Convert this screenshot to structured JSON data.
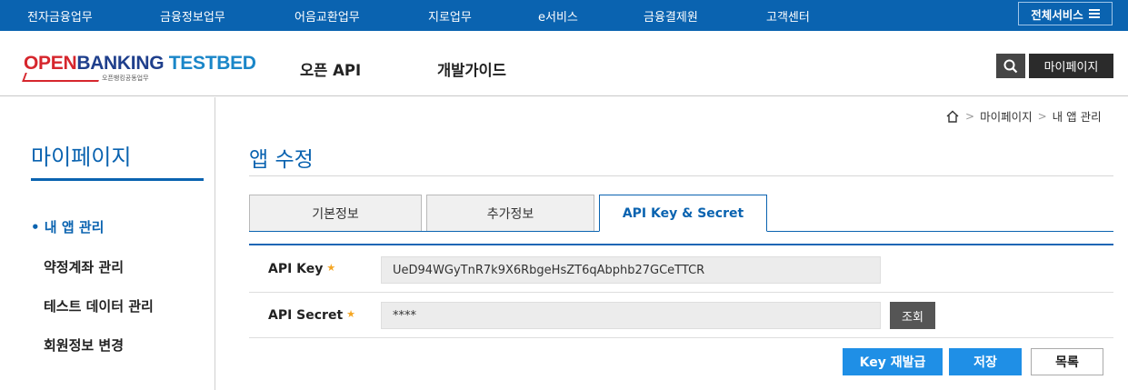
{
  "top_menu": [
    "전자금융업무",
    "금융정보업무",
    "어음교환업무",
    "지로업무",
    "e서비스",
    "금융결제원",
    "고객센터"
  ],
  "all_services_label": "전체서비스",
  "logo": {
    "open": "OPEN",
    "banking": "BANKING",
    "testbed": " TESTBED",
    "subtitle": "오픈뱅킹공동업무"
  },
  "gnb": [
    "오픈 API",
    "개발가이드"
  ],
  "header_buttons": {
    "search_icon": "search-icon",
    "mypage": "마이페이지"
  },
  "sidebar": {
    "title": "마이페이지",
    "items": [
      {
        "label": "• 내 앱 관리",
        "active": true
      },
      {
        "label": "약정계좌 관리",
        "active": false
      },
      {
        "label": "테스트 데이터 관리",
        "active": false
      },
      {
        "label": "회원정보 변경",
        "active": false
      }
    ]
  },
  "breadcrumb": {
    "home_icon": "home-icon",
    "items": [
      "마이페이지",
      "내 앱 관리"
    ]
  },
  "page_title": "앱 수정",
  "tabs": [
    {
      "label": "기본정보",
      "active": false
    },
    {
      "label": "추가정보",
      "active": false
    },
    {
      "label": "API Key & Secret",
      "active": true
    }
  ],
  "form": {
    "api_key": {
      "label": "API Key",
      "required": "★",
      "value": "UeD94WGyTnR7k9X6RbgeHsZT6qAbphb27GCeTTCR"
    },
    "api_secret": {
      "label": "API Secret",
      "required": "★",
      "value": "****",
      "view_button": "조회"
    }
  },
  "actions": {
    "reissue": "Key 재발급",
    "save": "저장",
    "list": "목록"
  },
  "colors": {
    "primary": "#0a63b0",
    "button_blue": "#1f8fe6",
    "star": "#f5a623"
  }
}
